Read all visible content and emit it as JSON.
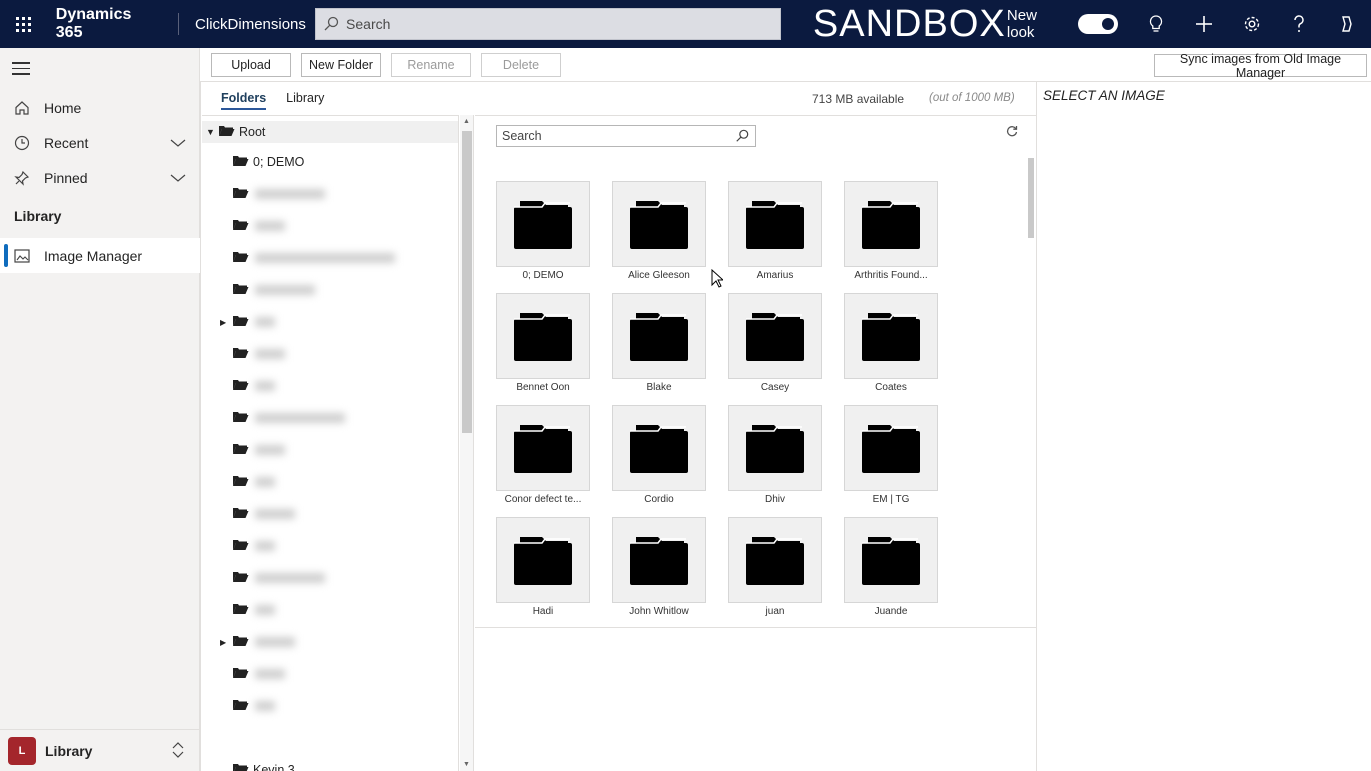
{
  "header": {
    "brand": "Dynamics 365",
    "app_name": "ClickDimensions",
    "search_placeholder": "Search",
    "environment_label": "SANDBOX",
    "new_look_label": "New look"
  },
  "nav": {
    "home": "Home",
    "recent": "Recent",
    "pinned": "Pinned",
    "group_label": "Library",
    "image_manager": "Image Manager",
    "area_badge": "L",
    "area_label": "Library"
  },
  "toolbar": {
    "upload": "Upload",
    "new_folder": "New Folder",
    "rename": "Rename",
    "delete": "Delete",
    "sync": "Sync images from Old Image Manager"
  },
  "tabs": {
    "folders": "Folders",
    "library": "Library"
  },
  "storage": {
    "available": "713 MB available",
    "total": "(out of 1000 MB)"
  },
  "tree": {
    "root": "Root",
    "first_child": "0; DEMO",
    "last_visible_partial": "Kevin 3"
  },
  "grid": {
    "search_placeholder": "Search",
    "folders": [
      "0; DEMO",
      "Alice Gleeson",
      "Amarius",
      "Arthritis Found...",
      "Bennet Oon",
      "Blake",
      "Casey",
      "Coates",
      "Conor defect te...",
      "Cordio",
      "Dhiv",
      "EM | TG",
      "Hadi",
      "John Whitlow",
      "juan",
      "Juande"
    ]
  },
  "detail": {
    "empty_message": "SELECT AN IMAGE"
  }
}
